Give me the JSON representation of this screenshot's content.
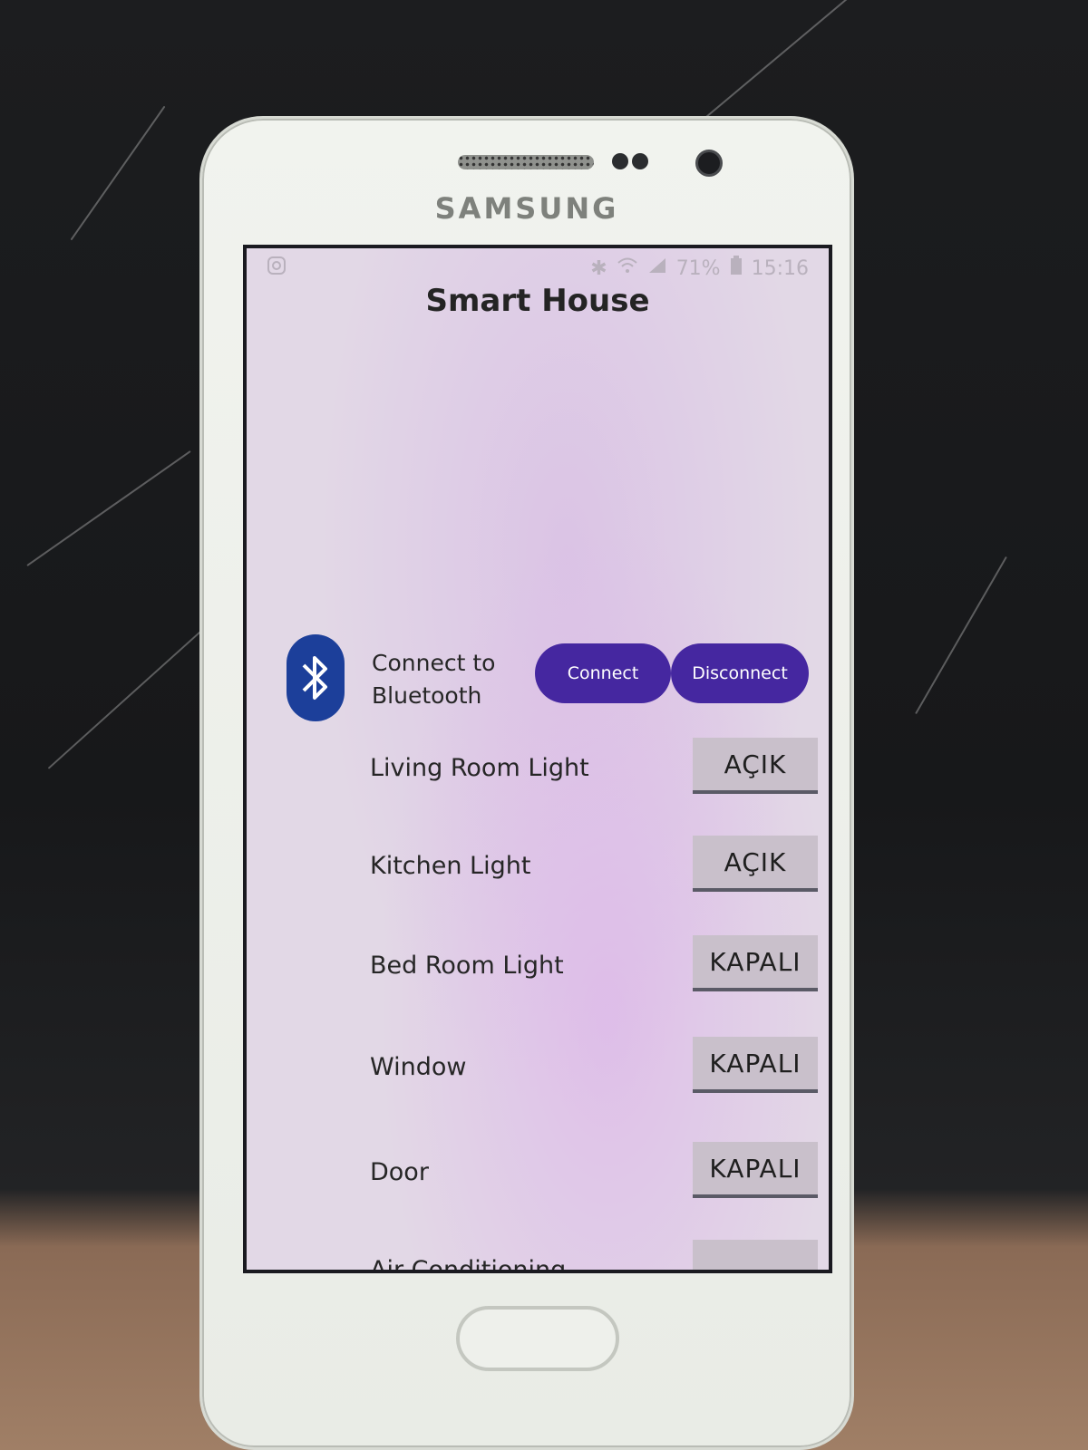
{
  "phone": {
    "brand": "SAMSUNG"
  },
  "statusbar": {
    "battery": "71%",
    "time": "15:16"
  },
  "app": {
    "title": "Smart House"
  },
  "bluetooth": {
    "label_line1": "Connect to",
    "label_line2": "Bluetooth",
    "connect_label": "Connect",
    "disconnect_label": "Disconnect"
  },
  "devices": [
    {
      "name": "Living Room Light",
      "state": "AÇIK"
    },
    {
      "name": "Kitchen Light",
      "state": "AÇIK"
    },
    {
      "name": "Bed Room Light",
      "state": "KAPALI"
    },
    {
      "name": "Window",
      "state": "KAPALI"
    },
    {
      "name": "Door",
      "state": "KAPALI"
    },
    {
      "name": "Air Conditioning",
      "state": ""
    }
  ],
  "colors": {
    "accent": "#4527a0",
    "bluetooth_icon": "#1c3f9a",
    "screen_bg": "#e2d8e6"
  }
}
